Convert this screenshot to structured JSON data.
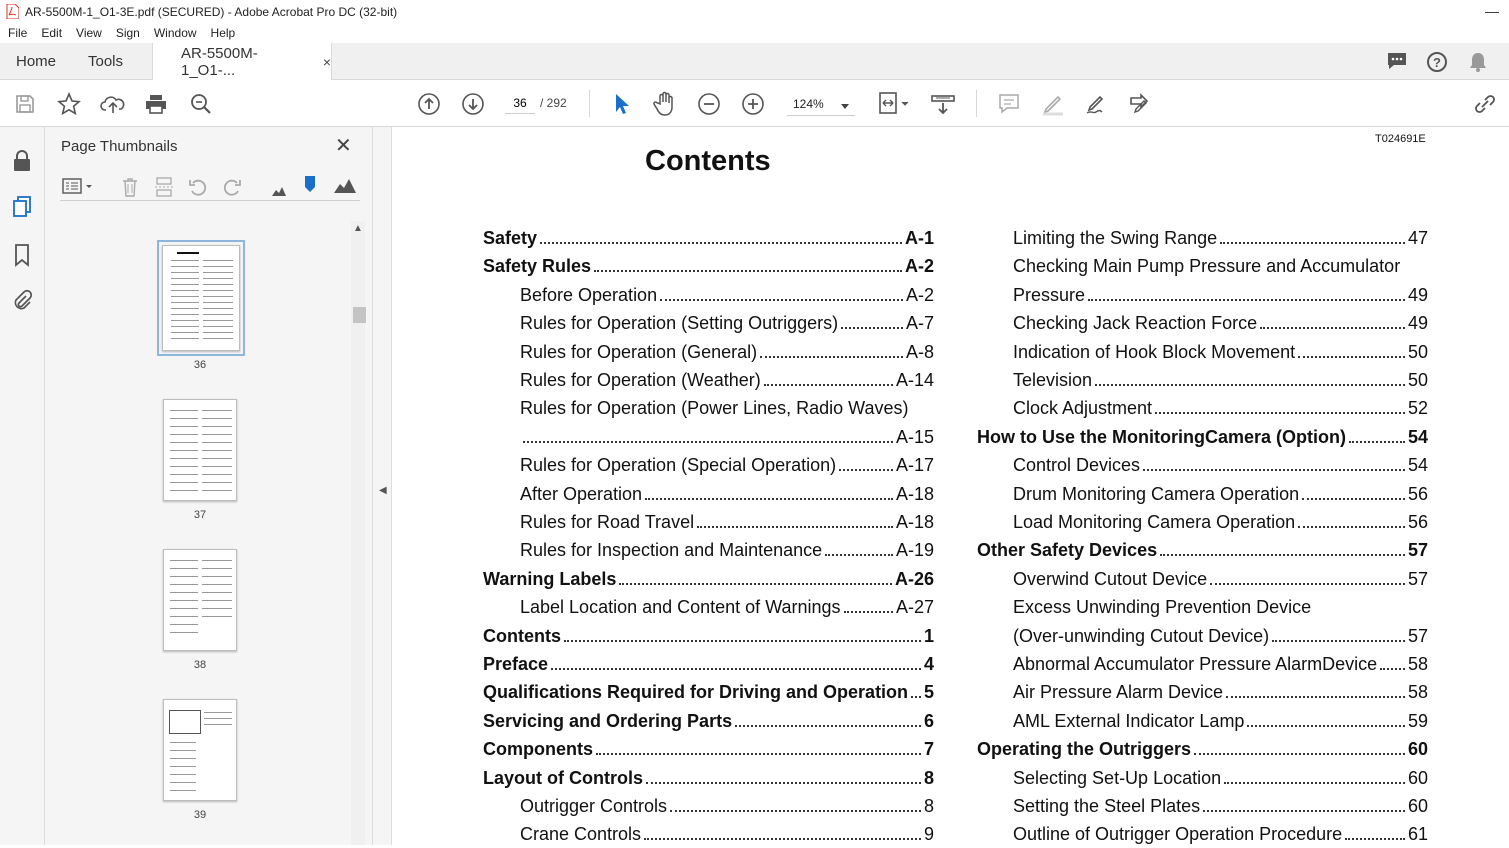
{
  "window": {
    "title": "AR-5500M-1_O1-3E.pdf (SECURED) - Adobe Acrobat Pro DC (32-bit)",
    "minimize": "—"
  },
  "menu": [
    "File",
    "Edit",
    "View",
    "Sign",
    "Window",
    "Help"
  ],
  "tabs": {
    "home": "Home",
    "tools": "Tools",
    "doc": "AR-5500M-1_O1-...",
    "close": "×"
  },
  "nav": {
    "page_current": "36",
    "page_total": "/ 292",
    "zoom": "124%"
  },
  "sidebar": {
    "title": "Page Thumbnails",
    "close": "✕",
    "thumbnails": [
      {
        "label": "36",
        "selected": true
      },
      {
        "label": "37",
        "selected": false
      },
      {
        "label": "38",
        "selected": false
      },
      {
        "label": "39",
        "selected": false
      }
    ]
  },
  "document": {
    "code": "T024691E",
    "heading": "Contents",
    "left_column": [
      {
        "text": "Safety",
        "page": "A-1",
        "bold": true,
        "indent": false
      },
      {
        "text": "Safety Rules",
        "page": "A-2",
        "bold": true,
        "indent": false
      },
      {
        "text": "Before Operation",
        "page": "A-2",
        "bold": false,
        "indent": true
      },
      {
        "text": "Rules for Operation (Setting Outriggers)",
        "page": "A-7",
        "bold": false,
        "indent": true
      },
      {
        "text": "Rules for Operation (General)",
        "page": "A-8",
        "bold": false,
        "indent": true
      },
      {
        "text": "Rules for Operation (Weather)",
        "page": "A-14",
        "bold": false,
        "indent": true
      },
      {
        "text": "Rules for Operation (Power Lines, Radio Waves)",
        "page": "",
        "bold": false,
        "indent": true
      },
      {
        "text": "",
        "page": "A-15",
        "bold": false,
        "indent": true
      },
      {
        "text": "Rules for Operation (Special Operation)",
        "page": "A-17",
        "bold": false,
        "indent": true
      },
      {
        "text": "After Operation",
        "page": "A-18",
        "bold": false,
        "indent": true
      },
      {
        "text": "Rules for Road Travel",
        "page": "A-18",
        "bold": false,
        "indent": true
      },
      {
        "text": "Rules for Inspection and Maintenance",
        "page": "A-19",
        "bold": false,
        "indent": true
      },
      {
        "text": "Warning Labels",
        "page": "A-26",
        "bold": true,
        "indent": false
      },
      {
        "text": "Label Location and Content of Warnings",
        "page": "A-27",
        "bold": false,
        "indent": true
      },
      {
        "text": "Contents",
        "page": "1",
        "bold": true,
        "indent": false
      },
      {
        "text": "Preface",
        "page": "4",
        "bold": true,
        "indent": false
      },
      {
        "text": "Qualifications Required for Driving and Operation",
        "page": "5",
        "bold": true,
        "indent": false
      },
      {
        "text": "Servicing and Ordering Parts",
        "page": "6",
        "bold": true,
        "indent": false
      },
      {
        "text": "Components",
        "page": "7",
        "bold": true,
        "indent": false
      },
      {
        "text": "Layout of Controls",
        "page": "8",
        "bold": true,
        "indent": false
      },
      {
        "text": "Outrigger Controls",
        "page": "8",
        "bold": false,
        "indent": true
      },
      {
        "text": "Crane Controls",
        "page": "9",
        "bold": false,
        "indent": true
      }
    ],
    "right_column": [
      {
        "text": "Limiting the Swing Range",
        "page": "47",
        "bold": false,
        "indent": true
      },
      {
        "text": "Checking Main Pump Pressure and Accumulator",
        "page": "",
        "bold": false,
        "indent": true
      },
      {
        "text": "Pressure",
        "page": "49",
        "bold": false,
        "indent": true
      },
      {
        "text": "Checking Jack Reaction Force",
        "page": "49",
        "bold": false,
        "indent": true
      },
      {
        "text": "Indication of Hook Block Movement",
        "page": "50",
        "bold": false,
        "indent": true
      },
      {
        "text": "Television",
        "page": "50",
        "bold": false,
        "indent": true
      },
      {
        "text": "Clock Adjustment",
        "page": "52",
        "bold": false,
        "indent": true
      },
      {
        "text": "How to Use the MonitoringCamera (Option)",
        "page": "54",
        "bold": true,
        "indent": false
      },
      {
        "text": "Control Devices",
        "page": "54",
        "bold": false,
        "indent": true
      },
      {
        "text": "Drum Monitoring Camera Operation",
        "page": "56",
        "bold": false,
        "indent": true
      },
      {
        "text": "Load Monitoring Camera Operation",
        "page": "56",
        "bold": false,
        "indent": true
      },
      {
        "text": "Other Safety Devices",
        "page": "57",
        "bold": true,
        "indent": false
      },
      {
        "text": "Overwind Cutout Device",
        "page": "57",
        "bold": false,
        "indent": true
      },
      {
        "text": "Excess Unwinding Prevention Device",
        "page": "",
        "bold": false,
        "indent": true
      },
      {
        "text": "(Over-unwinding Cutout Device)",
        "page": "57",
        "bold": false,
        "indent": true
      },
      {
        "text": "Abnormal Accumulator Pressure AlarmDevice",
        "page": "58",
        "bold": false,
        "indent": true
      },
      {
        "text": "Air Pressure Alarm Device",
        "page": "58",
        "bold": false,
        "indent": true
      },
      {
        "text": "AML External Indicator Lamp",
        "page": "59",
        "bold": false,
        "indent": true
      },
      {
        "text": "Operating the Outriggers",
        "page": "60",
        "bold": true,
        "indent": false
      },
      {
        "text": "Selecting Set-Up Location",
        "page": "60",
        "bold": false,
        "indent": true
      },
      {
        "text": "Setting the Steel Plates",
        "page": "60",
        "bold": false,
        "indent": true
      },
      {
        "text": "Outline of Outrigger Operation Procedure",
        "page": "61",
        "bold": false,
        "indent": true
      }
    ]
  }
}
